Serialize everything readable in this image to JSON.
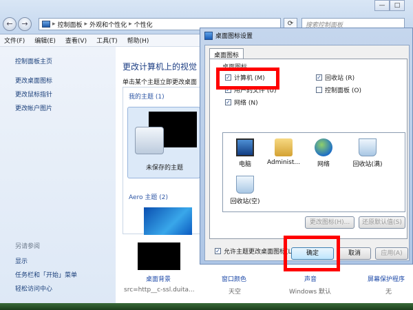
{
  "window": {
    "back_glyph": "←",
    "forward_glyph": "→",
    "minimize": "—",
    "maximize": "□",
    "refresh_glyph": "⟳"
  },
  "address": {
    "segments": [
      "控制面板",
      "外观和个性化",
      "个性化"
    ],
    "separator": "▸"
  },
  "search": {
    "placeholder": "搜索控制面板"
  },
  "menu": [
    "文件(F)",
    "编辑(E)",
    "查看(V)",
    "工具(T)",
    "帮助(H)"
  ],
  "sidebar": {
    "links": [
      "控制面板主页",
      "更改桌面图标",
      "更改鼠标指针",
      "更改帐户图片"
    ],
    "see_also_title": "另请参阅",
    "see_also": [
      "显示",
      "任务栏和「开始」菜单",
      "轻松访问中心"
    ]
  },
  "main": {
    "title": "更改计算机上的视觉",
    "subtitle": "单击某个主题立即更改桌面",
    "my_themes": "我的主题 (1)",
    "unsaved_theme": "未保存的主题",
    "aero_themes": "Aero 主题 (2)"
  },
  "bottom": {
    "desktop_bg": "桌面背景",
    "desktop_bg_val": "src=http__c-ssl.duita...",
    "window_color": "窗口颜色",
    "window_color_val": "天空",
    "sound": "声音",
    "sound_val": "Windows 默认",
    "screensaver": "屏幕保护程序",
    "screensaver_val": "无"
  },
  "dialog": {
    "title": "桌面图标设置",
    "tab": "桌面图标",
    "group": "桌面图标",
    "checkboxes": [
      {
        "label": "计算机 (M)",
        "checked": true
      },
      {
        "label": "回收站 (R)",
        "checked": true
      },
      {
        "label": "用户的文件 (U)",
        "checked": true
      },
      {
        "label": "控制面板 (O)",
        "checked": false
      },
      {
        "label": "网络 (N)",
        "checked": true
      }
    ],
    "icons": [
      "电脑",
      "Administ...",
      "网络",
      "回收站(满)",
      "回收站(空)"
    ],
    "change_icon": "更改图标(H)...",
    "restore_default": "还原默认值(S)",
    "allow_themes": "允许主题更改桌面图标(L)",
    "ok": "确定",
    "cancel": "取消",
    "apply": "应用(A)",
    "check_glyph": "✓"
  },
  "colors": {
    "highlight": "#ff0000",
    "link": "#1e4aa8"
  }
}
